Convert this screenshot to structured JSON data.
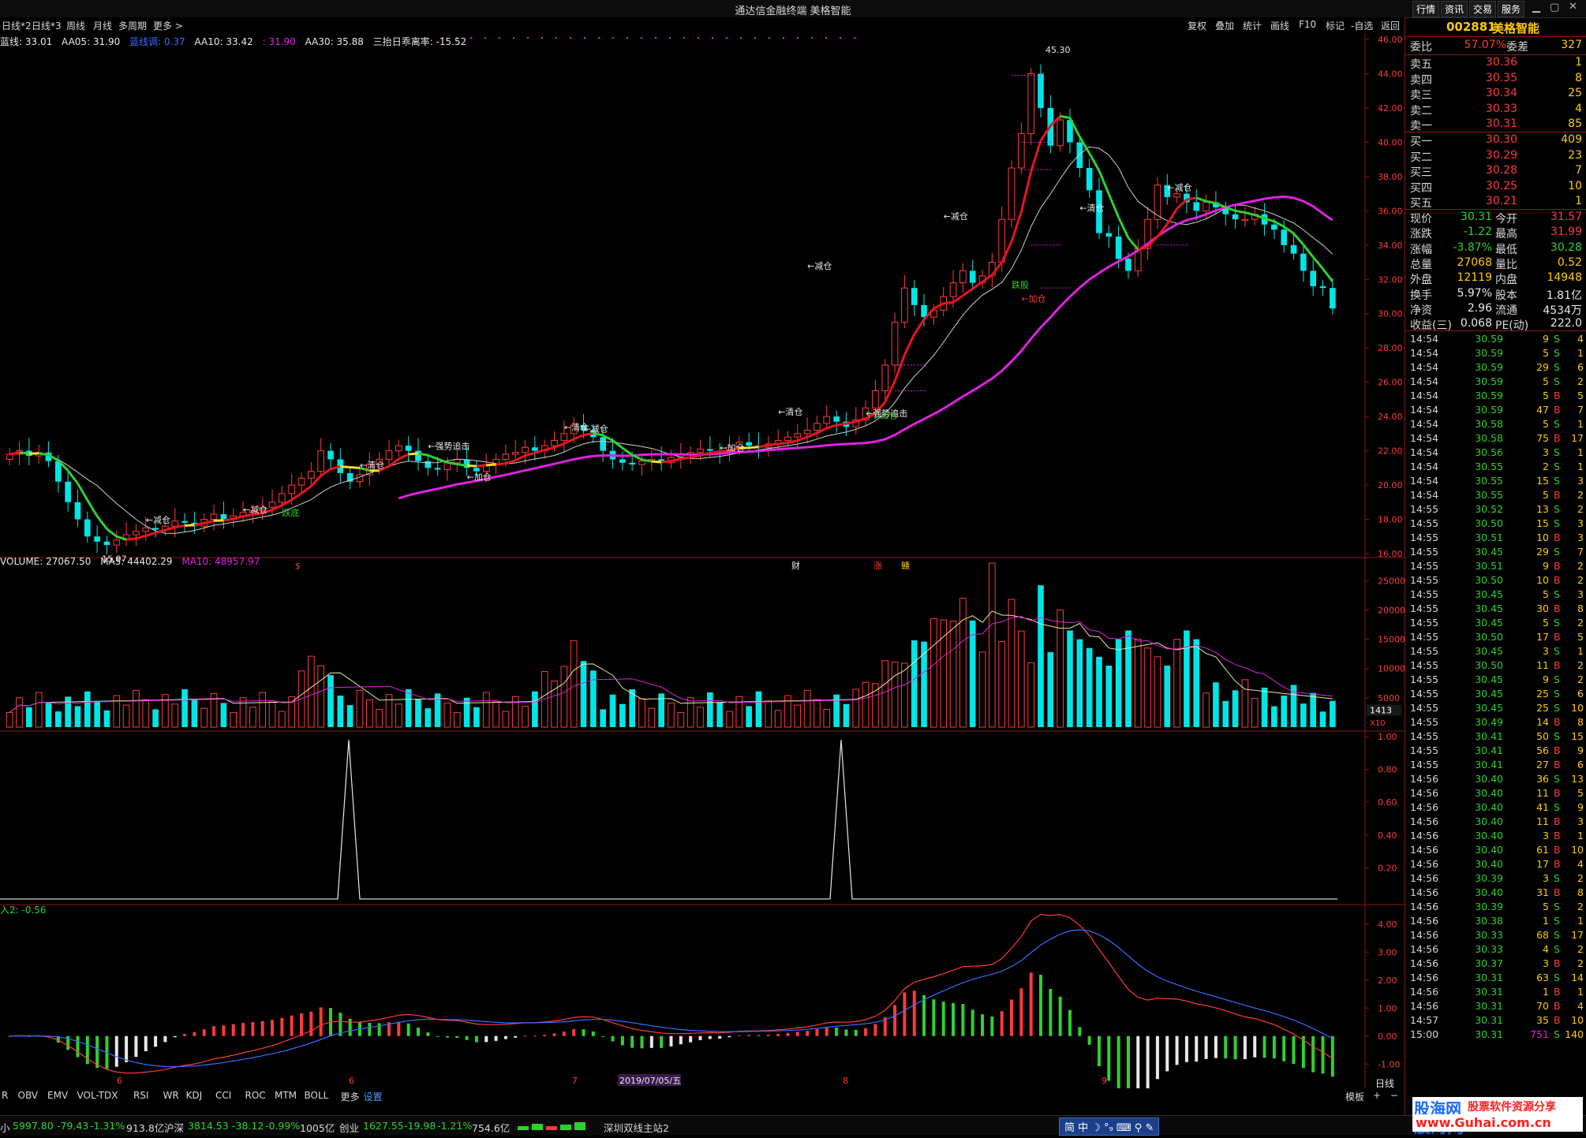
{
  "window_title": "通达信金融终端  美格智能",
  "period_menu": [
    "日线*2",
    "日线*3",
    "周线",
    "月线",
    "多周期",
    "更多 >"
  ],
  "top_right_menu": [
    "复权",
    "叠加",
    "统计",
    "画线",
    "F10",
    "标记",
    "-自选",
    "返回"
  ],
  "top_tabs": [
    "行情",
    "资讯",
    "交易",
    "服务"
  ],
  "main_indicators": {
    "l1": "蓝线: 33.01",
    "l2": "AA05: 31.90",
    "l3": "蓝线调: 0.37",
    "l4": "AA10: 33.42",
    "l5": ": 31.90",
    "l6": "AA30: 35.88",
    "l7": "三抬日乖离率: -15.52"
  },
  "main_axis": [
    "46.00",
    "44.00",
    "42.00",
    "40.00",
    "38.00",
    "36.00",
    "34.00",
    "32.00",
    "30.00",
    "28.00",
    "26.00",
    "24.00",
    "22.00",
    "20.00",
    "18.00",
    "16.00"
  ],
  "chart_annotations": {
    "high": "45.30",
    "low": "15.97",
    "a1": "←减仓",
    "a2": "←减仓",
    "a3": "←清仓",
    "a4": "←强势追击",
    "a5": "←加仓",
    "a6": "←清仓",
    "a7": "←减仓",
    "a8": "←加仓",
    "a9": "←清仓",
    "a10": "←强势追击",
    "a11": "←减仓",
    "b1": "跌底",
    "b2": "跌股",
    "b3": "←加仓",
    "b4": "↑↓加仓",
    "mk1": "$",
    "mk2": "财",
    "mk3": "涨",
    "mk4": "赣"
  },
  "vol_indicators": {
    "v1": "VOLUME: 27067.50",
    "v2": "MA5: 44402.29",
    "v3": "MA10: 48957.97"
  },
  "vol_axis": [
    "25000",
    "20000",
    "15000",
    "10000",
    "5000"
  ],
  "vol_label": "1413",
  "vol_unit": "X10",
  "ind3_axis": [
    "1.00",
    "0.80",
    "0.60",
    "0.40",
    "0.20"
  ],
  "ind4_indicators": {
    "i1": "入2: -0.56"
  },
  "ind4_axis": [
    "4.00",
    "3.00",
    "2.00",
    "1.00",
    "0.00",
    "-1.00"
  ],
  "date_axis": {
    "d1": "6",
    "d2": "6",
    "d3": "7",
    "d4": "2019/07/05/五",
    "d5": "8",
    "d6": "9",
    "period": "日线"
  },
  "bottom_tabs": [
    "R",
    "OBV",
    "EMV",
    "VOL-TDX",
    "RSI",
    "WR",
    "KDJ",
    "CCI",
    "ROC",
    "MTM",
    "BOLL",
    "更多",
    "设置"
  ],
  "bottom_right": [
    "模板",
    "+",
    "−"
  ],
  "stock": {
    "code": "002881",
    "name": "美格智能"
  },
  "quote": {
    "wb_label": "委比",
    "wb_val": "57.07%",
    "wc_label": "委差",
    "wc_val": "327",
    "asks": [
      [
        "卖五",
        "30.36",
        "1"
      ],
      [
        "卖四",
        "30.35",
        "8"
      ],
      [
        "卖三",
        "30.34",
        "25"
      ],
      [
        "卖二",
        "30.33",
        "4"
      ],
      [
        "卖一",
        "30.31",
        "85"
      ]
    ],
    "bids": [
      [
        "买一",
        "30.30",
        "409"
      ],
      [
        "买二",
        "30.29",
        "23"
      ],
      [
        "买三",
        "30.28",
        "7"
      ],
      [
        "买四",
        "30.25",
        "10"
      ],
      [
        "买五",
        "30.21",
        "1"
      ]
    ],
    "stats": [
      [
        "现价",
        "30.31",
        "今开",
        "31.57"
      ],
      [
        "涨跌",
        "-1.22",
        "最高",
        "31.99"
      ],
      [
        "涨幅",
        "-3.87%",
        "最低",
        "30.28"
      ],
      [
        "总量",
        "27068",
        "量比",
        "0.52"
      ],
      [
        "外盘",
        "12119",
        "内盘",
        "14948"
      ],
      [
        "换手",
        "5.97%",
        "股本",
        "1.81亿"
      ],
      [
        "净资",
        "2.96",
        "流通",
        "4534万"
      ],
      [
        "收益(三)",
        "0.068",
        "PE(动)",
        "222.0"
      ]
    ]
  },
  "ticks": [
    [
      "14:54",
      "30.59",
      "9",
      "S",
      "4"
    ],
    [
      "14:54",
      "30.59",
      "5",
      "S",
      "1"
    ],
    [
      "14:54",
      "30.59",
      "29",
      "S",
      "6"
    ],
    [
      "14:54",
      "30.59",
      "5",
      "S",
      "2"
    ],
    [
      "14:54",
      "30.59",
      "5",
      "B",
      "5"
    ],
    [
      "14:54",
      "30.59",
      "47",
      "B",
      "7"
    ],
    [
      "14:54",
      "30.58",
      "5",
      "S",
      "1"
    ],
    [
      "14:54",
      "30.58",
      "75",
      "B",
      "17"
    ],
    [
      "14:54",
      "30.56",
      "3",
      "S",
      "1"
    ],
    [
      "14:54",
      "30.55",
      "2",
      "S",
      "1"
    ],
    [
      "14:54",
      "30.55",
      "15",
      "S",
      "3"
    ],
    [
      "14:54",
      "30.55",
      "5",
      "B",
      "2"
    ],
    [
      "14:55",
      "30.52",
      "13",
      "S",
      "2"
    ],
    [
      "14:55",
      "30.50",
      "15",
      "S",
      "3"
    ],
    [
      "14:55",
      "30.51",
      "10",
      "B",
      "3"
    ],
    [
      "14:55",
      "30.45",
      "29",
      "S",
      "7"
    ],
    [
      "14:55",
      "30.51",
      "9",
      "B",
      "2"
    ],
    [
      "14:55",
      "30.50",
      "10",
      "B",
      "2"
    ],
    [
      "14:55",
      "30.45",
      "5",
      "S",
      "3"
    ],
    [
      "14:55",
      "30.45",
      "30",
      "B",
      "8"
    ],
    [
      "14:55",
      "30.45",
      "5",
      "S",
      "2"
    ],
    [
      "14:55",
      "30.50",
      "17",
      "B",
      "5"
    ],
    [
      "14:55",
      "30.45",
      "3",
      "S",
      "1"
    ],
    [
      "14:55",
      "30.50",
      "11",
      "B",
      "2"
    ],
    [
      "14:55",
      "30.45",
      "9",
      "S",
      "2"
    ],
    [
      "14:55",
      "30.45",
      "25",
      "S",
      "6"
    ],
    [
      "14:55",
      "30.45",
      "25",
      "S",
      "10"
    ],
    [
      "14:55",
      "30.49",
      "14",
      "B",
      "8"
    ],
    [
      "14:55",
      "30.41",
      "50",
      "S",
      "15"
    ],
    [
      "14:55",
      "30.41",
      "56",
      "B",
      "9"
    ],
    [
      "14:55",
      "30.41",
      "27",
      "B",
      "6"
    ],
    [
      "14:56",
      "30.40",
      "36",
      "S",
      "13"
    ],
    [
      "14:56",
      "30.40",
      "11",
      "B",
      "5"
    ],
    [
      "14:56",
      "30.40",
      "41",
      "S",
      "9"
    ],
    [
      "14:56",
      "30.40",
      "11",
      "B",
      "3"
    ],
    [
      "14:56",
      "30.40",
      "3",
      "B",
      "1"
    ],
    [
      "14:56",
      "30.40",
      "61",
      "B",
      "10"
    ],
    [
      "14:56",
      "30.40",
      "17",
      "B",
      "4"
    ],
    [
      "14:56",
      "30.39",
      "3",
      "S",
      "2"
    ],
    [
      "14:56",
      "30.40",
      "31",
      "B",
      "8"
    ],
    [
      "14:56",
      "30.39",
      "5",
      "S",
      "2"
    ],
    [
      "14:56",
      "30.38",
      "1",
      "S",
      "1"
    ],
    [
      "14:56",
      "30.33",
      "68",
      "S",
      "17"
    ],
    [
      "14:56",
      "30.33",
      "4",
      "S",
      "2"
    ],
    [
      "14:56",
      "30.37",
      "3",
      "B",
      "2"
    ],
    [
      "14:56",
      "30.31",
      "63",
      "S",
      "14"
    ],
    [
      "14:56",
      "30.31",
      "1",
      "B",
      "1"
    ],
    [
      "14:56",
      "30.31",
      "70",
      "B",
      "4"
    ],
    [
      "14:57",
      "30.31",
      "35",
      "B",
      "10"
    ],
    [
      "15:00",
      "30.31",
      "751",
      "S",
      "140"
    ]
  ],
  "statusbar": {
    "s1_name": "小",
    "s1_val": "5997.80",
    "s1_chg": "-79.43",
    "s1_pct": "-1.31%",
    "s1_amt": "913.8亿",
    "s2_name": "沪深",
    "s2_val": "3814.53",
    "s2_chg": "-38.12",
    "s2_pct": "-0.99%",
    "s2_amt": "1005亿",
    "s3_name": "创业",
    "s3_val": "1627.55",
    "s3_chg": "-19.98",
    "s3_pct": "-1.21%",
    "s3_amt": "754.6亿",
    "server": "深圳双线主站2",
    "ime": "简 中 ☽ °₉ ⌨ ⚲ ✎"
  },
  "watermark": {
    "site": "股海网",
    "slogan": "股票软件资源分享",
    "url": "www.Guhai.com.cn"
  },
  "colors": {
    "up": "#ff3a3a",
    "down": "#00e5e5",
    "ma_red": "#e8141c",
    "ma_green": "#30d030",
    "ma_yellow": "#f0e030",
    "ma30": "#e020e0",
    "white": "#e8e8e8"
  },
  "chart_data": {
    "type": "candlestick",
    "price_axis": [
      16,
      46
    ],
    "closes": [
      21.8,
      22.0,
      21.7,
      21.9,
      21.4,
      20.2,
      19.0,
      18.0,
      17.0,
      16.7,
      16.5,
      16.8,
      17.1,
      17.3,
      17.5,
      17.4,
      17.6,
      17.9,
      17.8,
      17.6,
      18.0,
      18.3,
      18.0,
      18.2,
      18.4,
      18.5,
      18.7,
      19.0,
      19.5,
      20.0,
      20.4,
      20.8,
      22.0,
      21.5,
      20.7,
      20.2,
      20.6,
      21.2,
      21.5,
      22.0,
      22.3,
      22.0,
      21.4,
      21.0,
      20.9,
      21.3,
      21.5,
      21.0,
      20.8,
      21.2,
      21.5,
      21.8,
      21.9,
      22.2,
      22.0,
      22.3,
      22.6,
      23.0,
      23.5,
      23.2,
      22.8,
      22.0,
      21.5,
      21.3,
      21.2,
      21.4,
      21.5,
      21.3,
      21.6,
      21.8,
      21.9,
      22.1,
      22.0,
      21.9,
      22.2,
      22.5,
      22.3,
      22.2,
      22.4,
      22.6,
      22.8,
      23.0,
      23.2,
      23.6,
      24.0,
      23.7,
      23.4,
      23.8,
      24.5,
      25.5,
      27.0,
      29.5,
      31.5,
      30.5,
      29.8,
      30.2,
      31.0,
      31.8,
      32.5,
      31.8,
      32.2,
      33.0,
      35.5,
      38.5,
      40.5,
      44.0,
      42.0,
      39.8,
      41.3,
      40.0,
      38.5,
      37.2,
      34.7,
      34.5,
      33.2,
      32.5,
      33.8,
      35.5,
      37.5,
      36.8,
      37.0,
      36.5,
      36.0,
      36.5,
      36.2,
      35.8,
      35.5,
      35.5,
      35.8,
      35.2,
      34.9,
      34.0,
      33.5,
      32.5,
      31.6,
      31.5,
      30.3
    ],
    "volume_series": [
      "VOLUME",
      "MA5",
      "MA10"
    ],
    "volume_axis": [
      0,
      28000
    ],
    "indicator3": {
      "axis": [
        0,
        1
      ],
      "spikes": [
        0.98,
        0.98
      ]
    },
    "indicator4": {
      "axis": [
        -1.5,
        4.5
      ],
      "series": [
        "DIF",
        "DEA",
        "MACD"
      ]
    }
  }
}
